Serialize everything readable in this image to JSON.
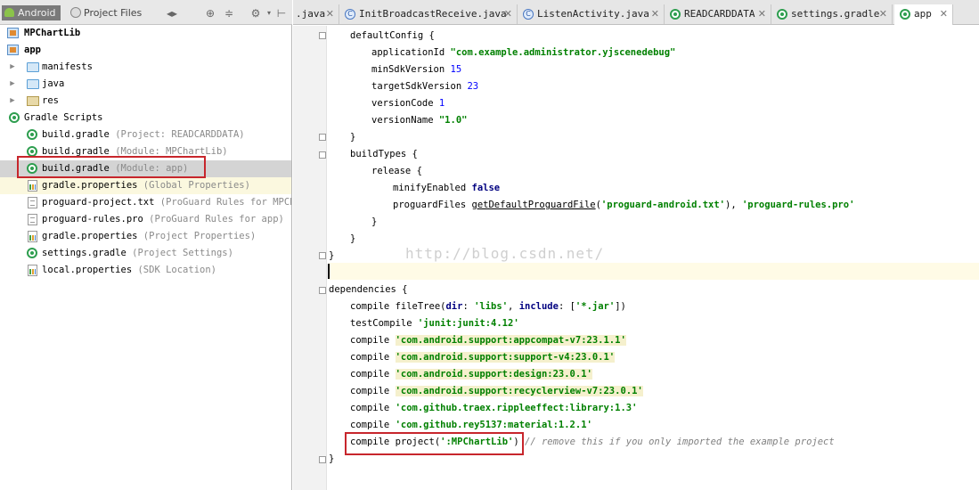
{
  "left_panel": {
    "tabs": {
      "android": "Android",
      "project_files": "Project Files"
    },
    "tree": [
      {
        "label": "MPChartLib",
        "hint": "",
        "icon": "module-icon"
      },
      {
        "label": "app",
        "hint": "",
        "icon": "module-icon"
      },
      {
        "label": "manifests",
        "hint": "",
        "icon": "folder-icon"
      },
      {
        "label": "java",
        "hint": "",
        "icon": "folder-icon"
      },
      {
        "label": "res",
        "hint": "",
        "icon": "res-folder-icon"
      },
      {
        "label": "Gradle Scripts",
        "hint": "",
        "icon": "gradle-icon"
      },
      {
        "label": "build.gradle",
        "hint": "(Project: READCARDDATA)",
        "icon": "gradle-icon"
      },
      {
        "label": "build.gradle",
        "hint": "(Module: MPChartLib)",
        "icon": "gradle-icon"
      },
      {
        "label": "build.gradle",
        "hint": "(Module: app)",
        "icon": "gradle-icon"
      },
      {
        "label": "gradle.properties",
        "hint": "(Global Properties)",
        "icon": "properties-icon"
      },
      {
        "label": "proguard-project.txt",
        "hint": "(ProGuard Rules for MPChar",
        "icon": "file-icon"
      },
      {
        "label": "proguard-rules.pro",
        "hint": "(ProGuard Rules for app)",
        "icon": "file-icon"
      },
      {
        "label": "gradle.properties",
        "hint": "(Project Properties)",
        "icon": "properties-icon"
      },
      {
        "label": "settings.gradle",
        "hint": "(Project Settings)",
        "icon": "gradle-icon"
      },
      {
        "label": "local.properties",
        "hint": "(SDK Location)",
        "icon": "properties-icon"
      }
    ]
  },
  "editor_tabs": [
    {
      "label": ".java",
      "icon": ""
    },
    {
      "label": "InitBroadcastReceive.java",
      "icon": "class-icon"
    },
    {
      "label": "ListenActivity.java",
      "icon": "class-icon"
    },
    {
      "label": "READCARDDATA",
      "icon": "gradle-icon"
    },
    {
      "label": "settings.gradle",
      "icon": "gradle-icon"
    },
    {
      "label": "app",
      "icon": "gradle-icon"
    }
  ],
  "code": {
    "l1": "defaultConfig {",
    "l2_a": "applicationId ",
    "l2_b": "\"com.example.administrator.yjscenedebug\"",
    "l3_a": "minSdkVersion ",
    "l3_b": "15",
    "l4_a": "targetSdkVersion ",
    "l4_b": "23",
    "l5_a": "versionCode ",
    "l5_b": "1",
    "l6_a": "versionName ",
    "l6_b": "\"1.0\"",
    "l7": "}",
    "l8": "buildTypes {",
    "l9": "release {",
    "l10_a": "minifyEnabled ",
    "l10_b": "false",
    "l11_a": "proguardFiles ",
    "l11_b": "getDefaultProguardFile",
    "l11_c": "(",
    "l11_d": "'proguard-android.txt'",
    "l11_e": "), ",
    "l11_f": "'proguard-rules.pro'",
    "l12": "}",
    "l13": "}",
    "l14": "}",
    "l16": "dependencies {",
    "l17_a": "compile fileTree(",
    "l17_b": "dir",
    "l17_c": ": ",
    "l17_d": "'libs'",
    "l17_e": ", ",
    "l17_f": "include",
    "l17_g": ": [",
    "l17_h": "'*.jar'",
    "l17_i": "])",
    "l18_a": "testCompile ",
    "l18_b": "'junit:junit:4.12'",
    "l19_a": "compile ",
    "l19_b": "'com.android.support:appcompat-v7:23.1.1'",
    "l20_a": "compile ",
    "l20_b": "'com.android.support:support-v4:23.0.1'",
    "l21_a": "compile ",
    "l21_b": "'com.android.support:design:23.0.1'",
    "l22_a": "compile ",
    "l22_b": "'com.android.support:recyclerview-v7:23.0.1'",
    "l23_a": "compile ",
    "l23_b": "'com.github.traex.rippleeffect:library:1.3'",
    "l24_a": "compile ",
    "l24_b": "'com.github.rey5137:material:1.2.1'",
    "l25_a": "compile project(",
    "l25_b": "':MPChartLib'",
    "l25_c": ")",
    "l25_d": " // remove this if you only imported the example project",
    "l26": "}"
  },
  "watermark": "http://blog.csdn.net/"
}
